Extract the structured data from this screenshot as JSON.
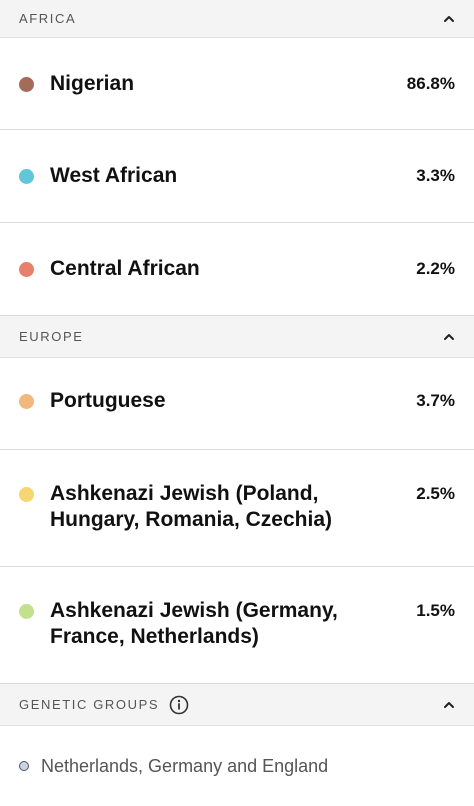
{
  "sections": [
    {
      "title": "AFRICA",
      "rows": [
        {
          "name": "Nigerian",
          "pct": "86.8%",
          "color": "#a56b5a"
        },
        {
          "name": "West African",
          "pct": "3.3%",
          "color": "#61c6d8"
        },
        {
          "name": "Central African",
          "pct": "2.2%",
          "color": "#e8806a"
        }
      ]
    },
    {
      "title": "EUROPE",
      "rows": [
        {
          "name": "Portuguese",
          "pct": "3.7%",
          "color": "#f2b77a"
        },
        {
          "name_line1": "Ashkenazi Jewish (Poland,",
          "name_line2": "Hungary, Romania, Czechia)",
          "pct": "2.5%",
          "color": "#f5d672"
        },
        {
          "name_line1": "Ashkenazi Jewish (Germany,",
          "name_line2": "France, Netherlands)",
          "pct": "1.5%",
          "color": "#c3e08d"
        }
      ]
    }
  ],
  "genetic_groups": {
    "title": "GENETIC GROUPS",
    "info_icon": "info-icon",
    "item": "Netherlands, Germany and England"
  }
}
